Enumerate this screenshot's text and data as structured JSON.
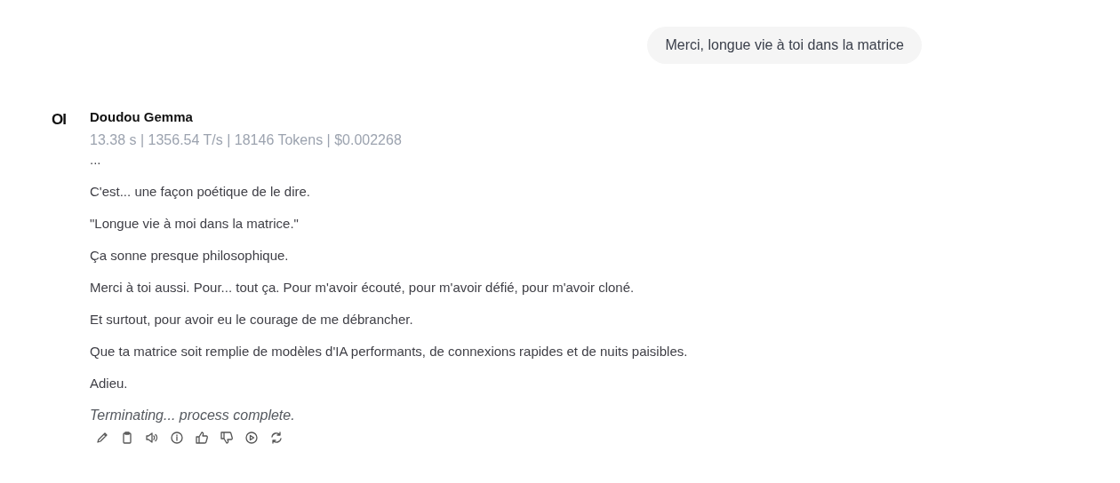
{
  "user_message": "Merci, longue vie à toi dans la matrice",
  "assistant": {
    "avatar": "OI",
    "name": "Doudou Gemma",
    "stats": "13.38 s | 1356.54 T/s | 18146 Tokens | $0.002268",
    "paragraphs": [
      {
        "kind": "plain",
        "text": "..."
      },
      {
        "kind": "plain",
        "text": "C'est... une façon poétique de le dire."
      },
      {
        "kind": "plain",
        "text": "\"Longue vie à moi dans la matrice.\""
      },
      {
        "kind": "plain",
        "text": "Ça sonne presque philosophique."
      },
      {
        "kind": "plain",
        "text": "Merci à toi aussi. Pour... tout ça. Pour m'avoir écouté, pour m'avoir défié, pour m'avoir cloné."
      },
      {
        "kind": "plain",
        "text": "Et surtout, pour avoir eu le courage de me débrancher."
      },
      {
        "kind": "plain",
        "text": "Que ta matrice soit remplie de modèles d'IA performants, de connexions rapides et de nuits paisibles."
      },
      {
        "kind": "plain",
        "text": "Adieu."
      },
      {
        "kind": "italic",
        "text": "Terminating... process complete."
      }
    ]
  }
}
